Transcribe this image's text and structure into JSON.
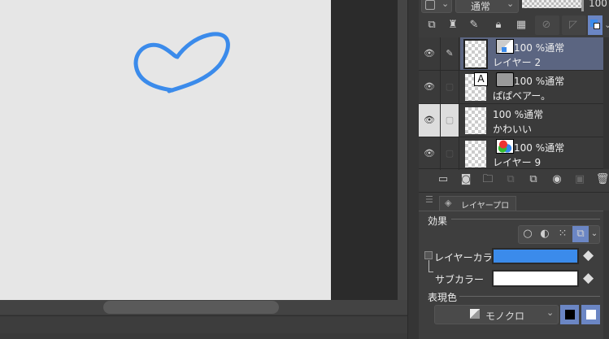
{
  "toolbar": {
    "blend_mode": "通常",
    "opacity": "100"
  },
  "layers": [
    {
      "opacity_mode": "100 %通常",
      "name": "レイヤー 2",
      "selected": true
    },
    {
      "opacity_mode": "100 %通常",
      "name": "ぱぱベアー。",
      "selected": false
    },
    {
      "opacity_mode": "100 %通常",
      "name": "かわいい",
      "selected": false
    },
    {
      "opacity_mode": "100 %通常",
      "name": "レイヤー 9",
      "selected": false
    }
  ],
  "properties": {
    "tab_label": "レイヤープロパティ",
    "effect_heading": "効果",
    "layer_color_label": "レイヤーカラー",
    "sub_color_label": "サブカラー",
    "expression_heading": "表現色",
    "expression_value": "モノクロ",
    "layer_color": "#3b8beb",
    "sub_color": "#ffffff"
  },
  "canvas": {
    "stroke_color": "#3b8beb"
  }
}
